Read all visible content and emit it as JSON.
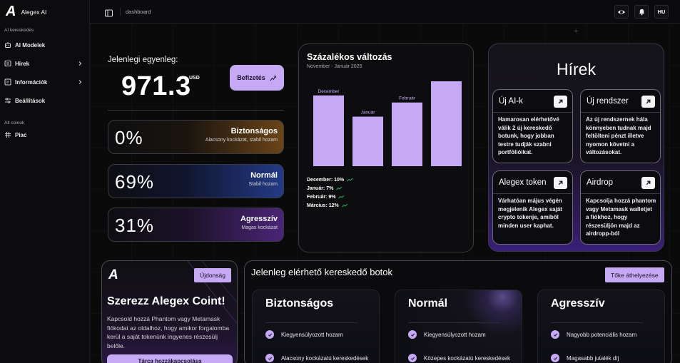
{
  "app": {
    "name": "Alegex AI",
    "logo_letter": "A"
  },
  "sidebar": {
    "section_trading": "AI kereskedés",
    "items": [
      {
        "label": "AI Modelek",
        "icon": "robot-icon",
        "has_chevron": false
      },
      {
        "label": "Hírek",
        "icon": "newspaper-icon",
        "has_chevron": true
      },
      {
        "label": "Információk",
        "icon": "info-icon",
        "has_chevron": true
      },
      {
        "label": "Beállítások",
        "icon": "settings-sliders-icon",
        "has_chevron": false
      }
    ],
    "section_altcoins": "Alt coinok",
    "market_item": {
      "label": "Piac",
      "icon": "grid-icon"
    }
  },
  "topbar": {
    "breadcrumb": "dashboard",
    "language": "HU"
  },
  "balance": {
    "label": "Jelenlegi egyenleg:",
    "amount": "971.3",
    "currency": "USD",
    "deposit_label": "Befizetés"
  },
  "allocations": [
    {
      "percent": "0%",
      "name": "Biztonságos",
      "desc": "Alacsony kockázat, stabil hozam",
      "accent": "#b8732a"
    },
    {
      "percent": "69%",
      "name": "Normál",
      "desc": "Stabil hozam",
      "accent": "#2a3a8a"
    },
    {
      "percent": "31%",
      "name": "Agresszív",
      "desc": "Magas kockázat",
      "accent": "#5a2a8a"
    }
  ],
  "chart": {
    "title": "Százalékos változás",
    "subtitle": "November - Január 2025",
    "legend": [
      {
        "label": "December: 10%"
      },
      {
        "label": "Január: 7%"
      },
      {
        "label": "Február: 9%"
      },
      {
        "label": "Március: 12%"
      }
    ],
    "trend_color": "#22c55e"
  },
  "chart_data": {
    "type": "bar",
    "categories": [
      "December",
      "Január",
      "Február",
      "Március"
    ],
    "bar_labels": [
      "December",
      "Január",
      "Február",
      ""
    ],
    "values": [
      10,
      7,
      9,
      12
    ],
    "title": "Százalékos változás",
    "subtitle": "November - Január 2025",
    "xlabel": "",
    "ylabel": "",
    "ylim": [
      0,
      12.5
    ],
    "grid": false,
    "bar_color": "#c6a9f5"
  },
  "news": {
    "title": "Hírek",
    "tiles": [
      {
        "title": "Új AI-k",
        "body": "Hamarosan elérhetővé válik 2 új kereskedő botunk, hogy jobban testre tudják szabni portfólióikat."
      },
      {
        "title": "Új rendszer",
        "body": "Az új rendszernek hála könnyeben tudnak majd feltölteni pénzt illetve nyomon követni a változásokat."
      },
      {
        "title": "Alegex token",
        "body": "Várhatóan május végén megjelenik Alegex saját crypto tokenje, amiből minden user kaphat."
      },
      {
        "title": "Airdrop",
        "body": "Kapcsolja hozzá phantom vagy Metamask walletjet a fiókhoz, hogy részesüljön majd az airdropp-ból"
      }
    ]
  },
  "promo": {
    "badge": "Újdonság",
    "title": "Szerezz Alegex Coint!",
    "body": "Kapcsold hozzá Phantom vagy Metamask fiókodat az oldalhoz, hogy amikor forgalomba kerül a saját tokenünk ingyenes részesülj belőle.",
    "button": "Tárca hozzákapcsolása"
  },
  "bots": {
    "title": "Jelenleg elérhető kereskedő botok",
    "move_button": "Tőke áthelyezése",
    "columns": [
      {
        "name": "Biztonságos",
        "features": [
          "Kiegyensúlyozott hozam",
          "Alacsony kockázatú kereskedések"
        ]
      },
      {
        "name": "Normál",
        "features": [
          "Kiegyensúlyozott hozam",
          "Közepes kockázatú kereskedések"
        ]
      },
      {
        "name": "Agresszív",
        "features": [
          "Nagyobb potenciális hozam",
          "Magasabb jutalék díj"
        ]
      }
    ]
  },
  "colors": {
    "accent": "#c6a9f5",
    "background": "#0a0a0b"
  }
}
